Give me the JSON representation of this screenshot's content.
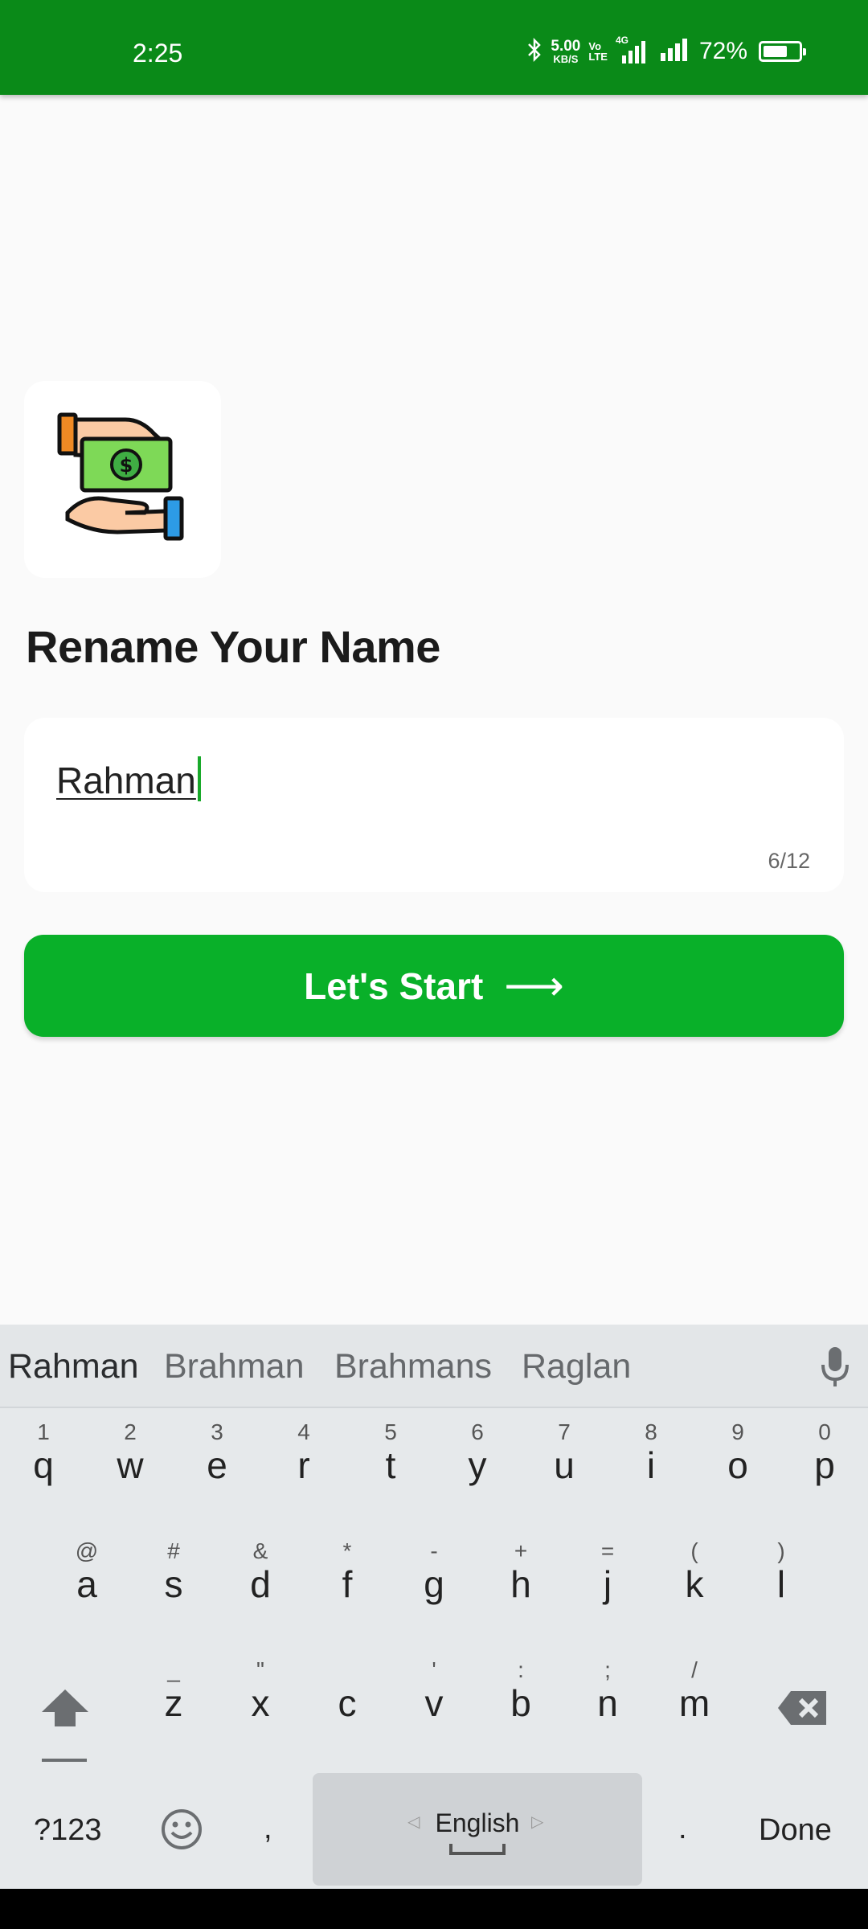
{
  "status_bar": {
    "time": "2:25",
    "net_speed_value": "5.00",
    "net_speed_unit": "KB/S",
    "volte_top": "Vo",
    "volte_bottom": "LTE",
    "network": "4G",
    "battery": "72%",
    "battery_level": 0.72
  },
  "app": {
    "title": "Rename Your Name",
    "name_input": {
      "value": "Rahman",
      "counter": "6/12"
    },
    "start_button_label": "Let's Start",
    "start_button_arrow": "⟶",
    "accent_color": "#09b029",
    "header_color": "#0a8a18"
  },
  "keyboard": {
    "suggestions": [
      "Rahman",
      "Brahman",
      "Brahmans",
      "Raglan"
    ],
    "row1": [
      {
        "key": "q",
        "hint": "1"
      },
      {
        "key": "w",
        "hint": "2"
      },
      {
        "key": "e",
        "hint": "3"
      },
      {
        "key": "r",
        "hint": "4"
      },
      {
        "key": "t",
        "hint": "5"
      },
      {
        "key": "y",
        "hint": "6"
      },
      {
        "key": "u",
        "hint": "7"
      },
      {
        "key": "i",
        "hint": "8"
      },
      {
        "key": "o",
        "hint": "9"
      },
      {
        "key": "p",
        "hint": "0"
      }
    ],
    "row2": [
      {
        "key": "a",
        "hint": "@"
      },
      {
        "key": "s",
        "hint": "#"
      },
      {
        "key": "d",
        "hint": "&"
      },
      {
        "key": "f",
        "hint": "*"
      },
      {
        "key": "g",
        "hint": "-"
      },
      {
        "key": "h",
        "hint": "+"
      },
      {
        "key": "j",
        "hint": "="
      },
      {
        "key": "k",
        "hint": "("
      },
      {
        "key": "l",
        "hint": ")"
      }
    ],
    "row3": [
      {
        "key": "z",
        "hint": "_"
      },
      {
        "key": "x",
        "hint": "\""
      },
      {
        "key": "c",
        "hint": ""
      },
      {
        "key": "v",
        "hint": "'"
      },
      {
        "key": "b",
        "hint": ":"
      },
      {
        "key": "n",
        "hint": ";"
      },
      {
        "key": "m",
        "hint": "/"
      }
    ],
    "symbols_key": "?123",
    "comma_key": ",",
    "space_label": "English",
    "period_key": ".",
    "done_key": "Done",
    "icons": [
      "shift-icon",
      "backspace-icon",
      "emoji-icon",
      "mic-icon"
    ]
  }
}
